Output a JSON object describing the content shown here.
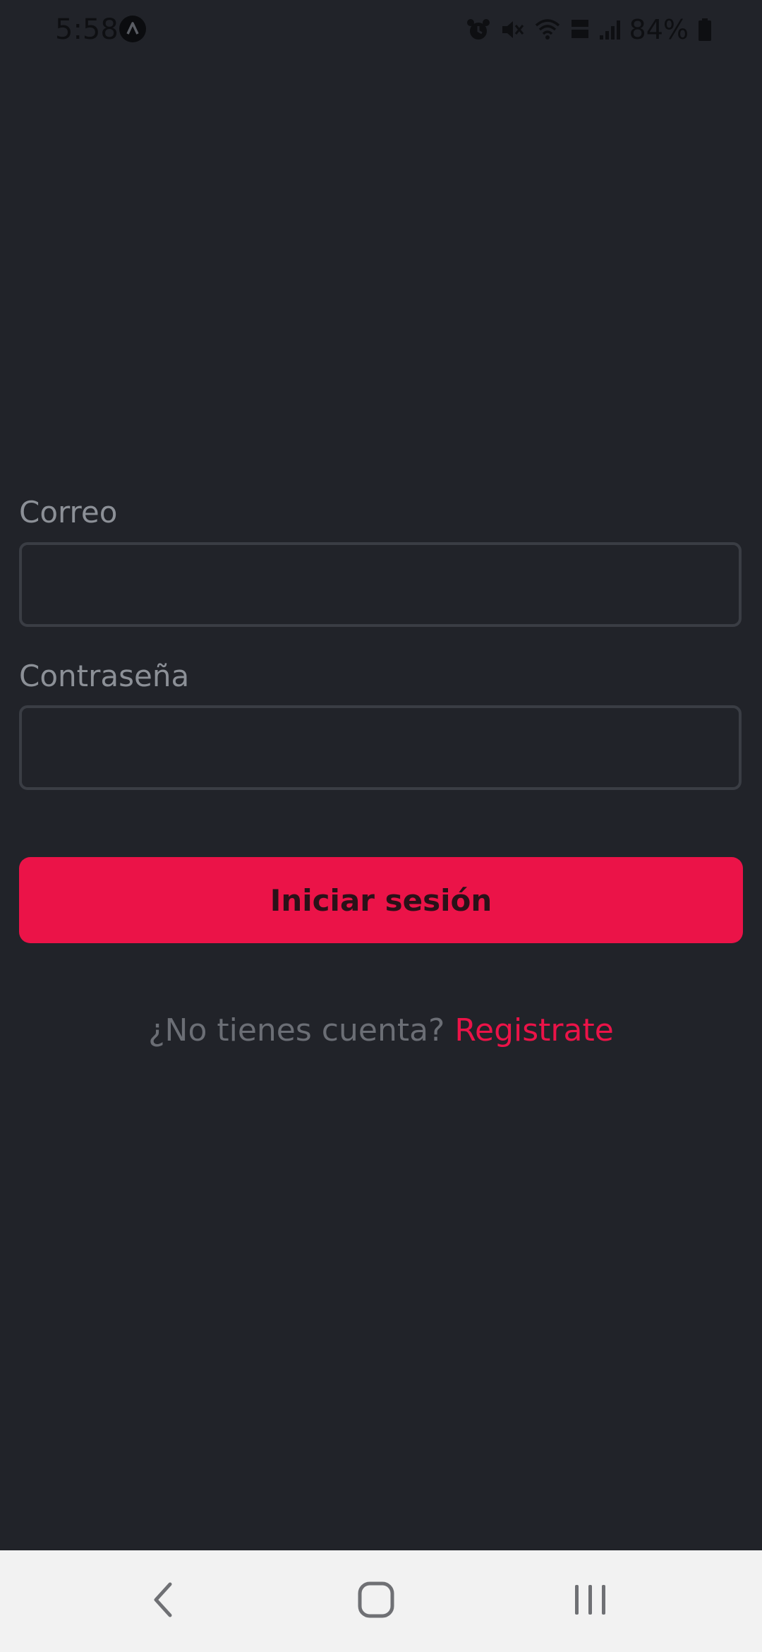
{
  "status_bar": {
    "time": "5:58",
    "battery_percent": "84%",
    "icons": [
      "app-notification-icon",
      "alarm-icon",
      "mute-icon",
      "wifi-icon",
      "volte-icon",
      "signal-icon",
      "battery-icon"
    ]
  },
  "login_form": {
    "email_label": "Correo",
    "email_value": "",
    "password_label": "Contraseña",
    "password_value": "",
    "submit_label": "Iniciar sesión"
  },
  "register": {
    "prompt": "¿No tienes cuenta?",
    "link_label": "Registrate"
  },
  "colors": {
    "background": "#212329",
    "accent": "#eb1348",
    "label": "#8c9097",
    "field_border": "#3a3d44",
    "nav_bar": "#f2f2f2"
  },
  "nav_bar": {
    "icons": [
      "back-icon",
      "home-icon",
      "recents-icon"
    ]
  }
}
